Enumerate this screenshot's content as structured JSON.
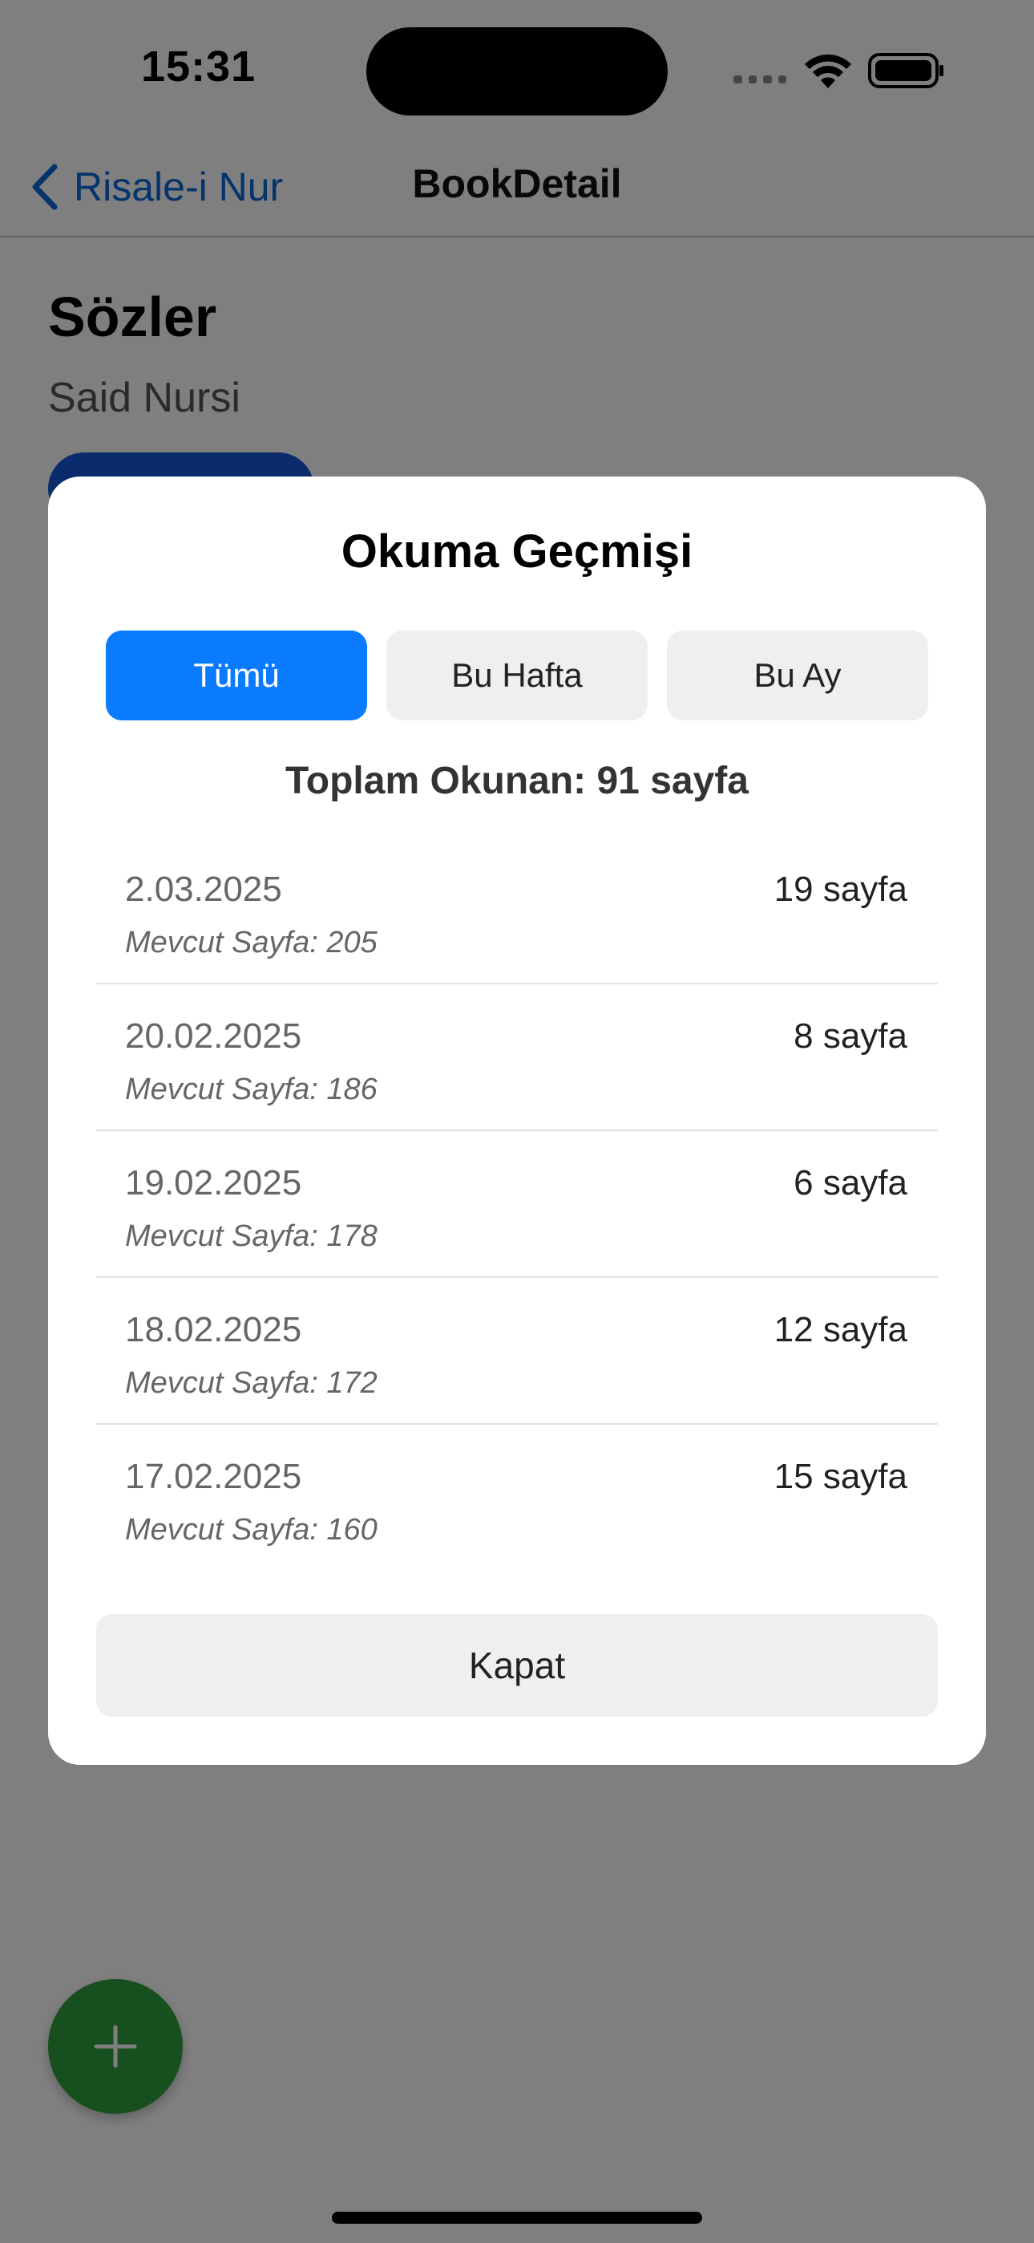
{
  "status_bar": {
    "time": "15:31"
  },
  "nav": {
    "back_label": "Risale-i Nur",
    "title": "BookDetail"
  },
  "book": {
    "title": "Sözler",
    "author": "Said Nursi"
  },
  "modal": {
    "title": "Okuma Geçmişi",
    "tabs": [
      {
        "label": "Tümü",
        "active": true
      },
      {
        "label": "Bu Hafta",
        "active": false
      },
      {
        "label": "Bu Ay",
        "active": false
      }
    ],
    "total": "Toplam Okunan: 91 sayfa",
    "entries": [
      {
        "date": "2.03.2025",
        "current_page": "Mevcut Sayfa: 205",
        "pages": "19 sayfa"
      },
      {
        "date": "20.02.2025",
        "current_page": "Mevcut Sayfa: 186",
        "pages": "8 sayfa"
      },
      {
        "date": "19.02.2025",
        "current_page": "Mevcut Sayfa: 178",
        "pages": "6 sayfa"
      },
      {
        "date": "18.02.2025",
        "current_page": "Mevcut Sayfa: 172",
        "pages": "12 sayfa"
      },
      {
        "date": "17.02.2025",
        "current_page": "Mevcut Sayfa: 160",
        "pages": "15 sayfa"
      }
    ],
    "close_label": "Kapat"
  },
  "icons": {
    "back": "chevron-left-icon",
    "fab": "plus-icon",
    "wifi": "wifi-icon",
    "battery": "battery-icon",
    "signal": "cellular-signal-icon"
  },
  "colors": {
    "accent": "#0a7bff",
    "link": "#0a66d8",
    "fab": "#2e9e3e",
    "chip": "#1459d9"
  }
}
